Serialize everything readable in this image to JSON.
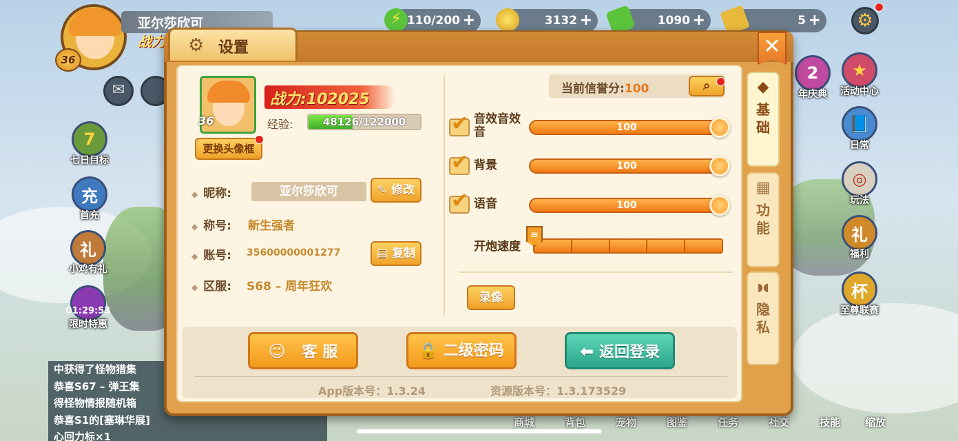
{
  "hud": {
    "player_name": "亚尔莎欣可",
    "player_level": "36",
    "power_short": "战力",
    "energy": "110/200",
    "gold": "3132",
    "cash": "1090",
    "tickets": "5",
    "plus": "+"
  },
  "left_icons": [
    {
      "icon": "seven-days-icon",
      "label": "七日目标",
      "glyph": "7"
    },
    {
      "icon": "first-recharge-icon",
      "label": "首充",
      "glyph": "充"
    },
    {
      "icon": "chick-gift-icon",
      "label": "小鸡有礼",
      "glyph": "礼"
    },
    {
      "icon": "limited-offer-icon",
      "label": "限时特惠",
      "timer": "01:29:53"
    }
  ],
  "right_icons": [
    {
      "icon": "anniversary-icon",
      "label": "年庆典",
      "glyph": "2"
    },
    {
      "icon": "event-center-icon",
      "label": "活动中心",
      "glyph": "★"
    },
    {
      "icon": "daily-icon",
      "label": "日常",
      "glyph": "📘"
    },
    {
      "icon": "gameplay-icon",
      "label": "玩法",
      "glyph": "◎"
    },
    {
      "icon": "welfare-icon",
      "label": "福利",
      "glyph": "礼"
    },
    {
      "icon": "supreme-league-icon",
      "label": "至尊联赛",
      "glyph": "杯"
    }
  ],
  "chat_lines": [
    "中获得了怪物猎集",
    "恭喜S67 – 弹王集",
    "得怪物情报随机箱",
    "恭喜S1的[塞琳华展]",
    "心回力标×1"
  ],
  "bottom_nav": [
    "商城",
    "背包",
    "宠物",
    "图鉴",
    "任务",
    "社交",
    "技能",
    "缩放"
  ],
  "dialog": {
    "title": "设置",
    "close": "✕",
    "side_tabs": [
      {
        "icon": "cube-icon",
        "glyph": "◆",
        "label_lines": [
          "基",
          "础"
        ]
      },
      {
        "icon": "function-icon",
        "glyph": "▦",
        "label_lines": [
          "功",
          "能"
        ]
      },
      {
        "icon": "mask-icon",
        "glyph": "◗◖",
        "label_lines": [
          "隐",
          "私"
        ]
      }
    ],
    "profile": {
      "level": "36",
      "power_label": "战力:",
      "power_value": "102025",
      "exp_label": "经验:",
      "exp_text": "48126/122000",
      "exp_fraction": 0.394,
      "change_avatar": "更换头像框",
      "nickname_label": "昵称:",
      "nickname": "亚尔莎欣可",
      "edit_button": "修改",
      "title_label": "称号:",
      "title_value": "新生强者",
      "account_label": "账号:",
      "account_value": "35600000001277",
      "copy_button": "复制",
      "server_label": "区服:",
      "server_value": "S68 – 周年狂欢"
    },
    "settings": {
      "credit_label": "当前信誉分:",
      "credit_value": "100",
      "sfx_label": "音效音效音",
      "bgm_label": "背景",
      "voice_label": "语音",
      "sfx_value": "100",
      "bgm_value": "100",
      "voice_value": "100",
      "fire_speed_label": "开炮速度",
      "record_button": "录像"
    },
    "actions": {
      "service": "客 服",
      "second_password": "二级密码",
      "back_login": "返回登录"
    },
    "versions": {
      "app": "App版本号：1.3.24",
      "resource": "资源版本号：1.3.173529"
    }
  }
}
